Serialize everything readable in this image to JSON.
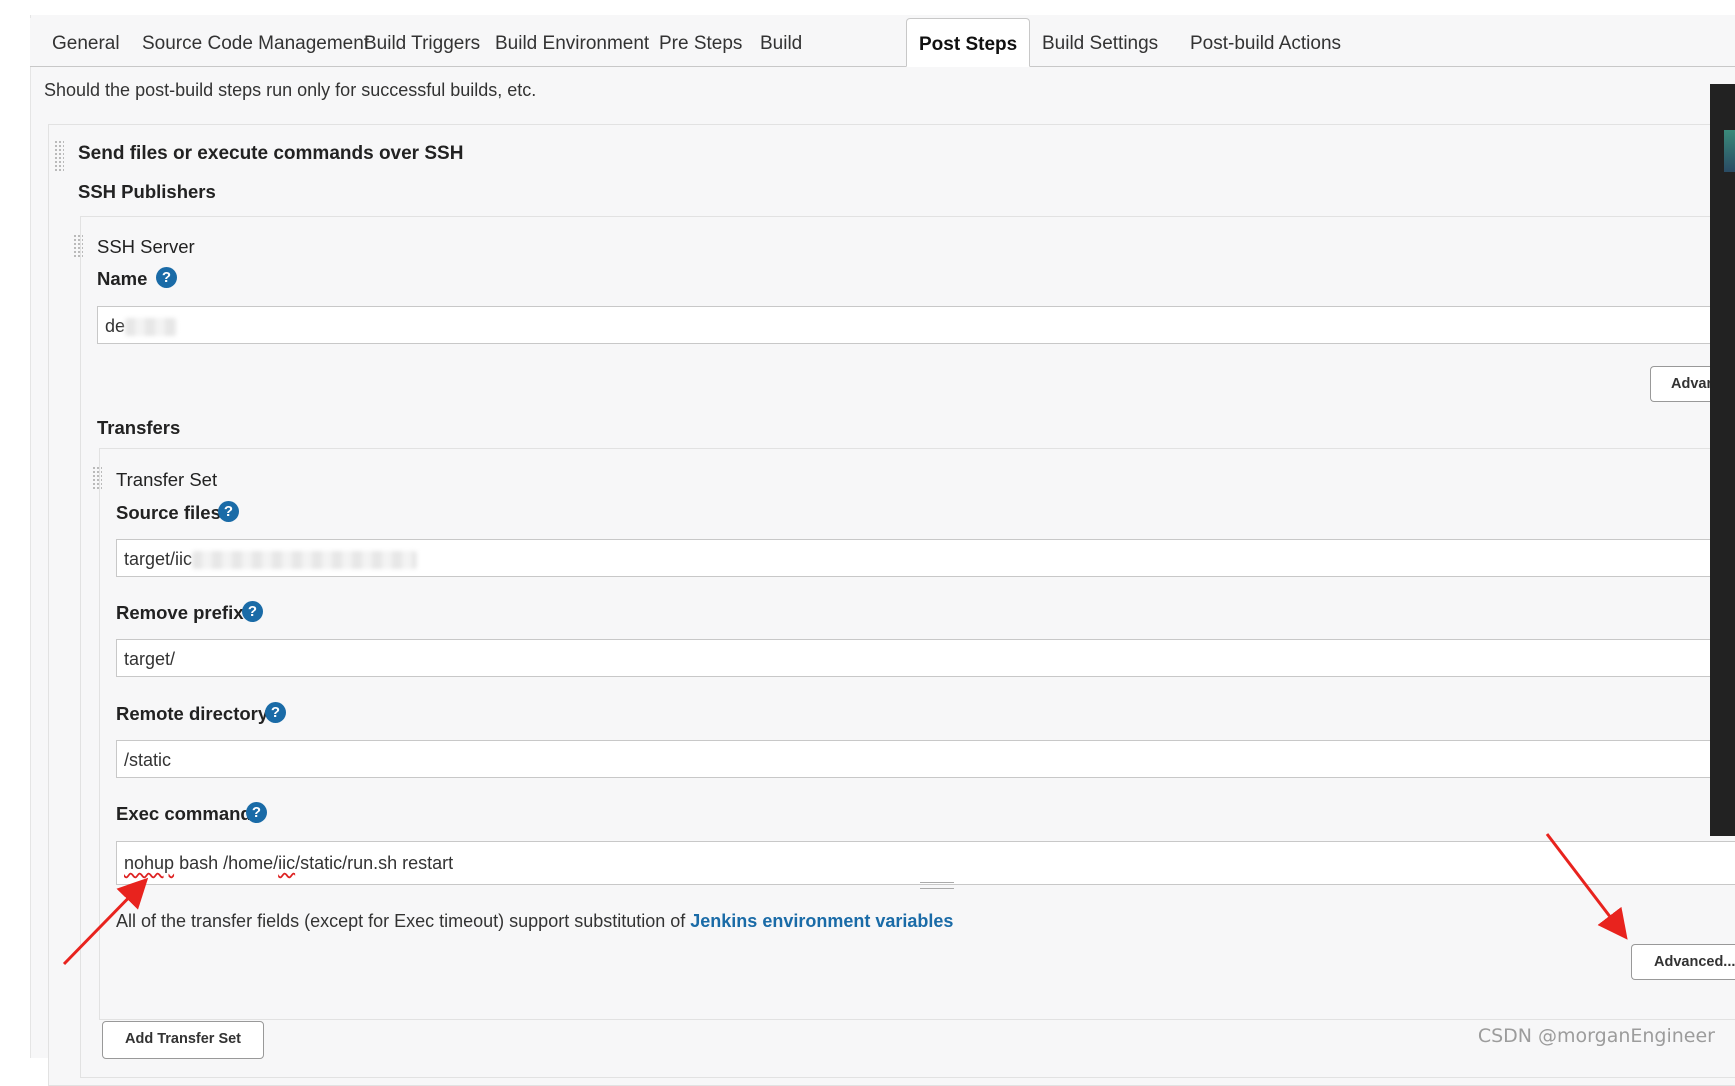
{
  "tabs": [
    {
      "label": "General",
      "active": false
    },
    {
      "label": "Source Code Management",
      "active": false
    },
    {
      "label": "Build Triggers",
      "active": false
    },
    {
      "label": "Build Environment",
      "active": false
    },
    {
      "label": "Pre Steps",
      "active": false
    },
    {
      "label": "Build",
      "active": false
    },
    {
      "label": "Post Steps",
      "active": true
    },
    {
      "label": "Build Settings",
      "active": false
    },
    {
      "label": "Post-build Actions",
      "active": false
    }
  ],
  "description": "Should the post-build steps run only for successful builds, etc.",
  "ssh_section": {
    "title": "Send files or execute commands over SSH",
    "publishers_label": "SSH Publishers",
    "server": {
      "heading": "SSH Server",
      "name_label": "Name",
      "name_value": "de",
      "advanced_button": "Advan"
    },
    "transfers_label": "Transfers",
    "transfer_set": {
      "heading": "Transfer Set",
      "source_files_label": "Source files",
      "source_files_value": "target/iic",
      "remove_prefix_label": "Remove prefix",
      "remove_prefix_value": "target/",
      "remote_directory_label": "Remote directory",
      "remote_directory_value": "/static",
      "exec_command_label": "Exec command",
      "exec_command_word1": "nohup",
      "exec_command_part2": " bash /home/",
      "exec_command_word2": "iic",
      "exec_command_part3": "/static/run.sh restart",
      "note_text": "All of the transfer fields (except for Exec timeout) support substitution of ",
      "note_link": "Jenkins environment variables",
      "advanced_button": "Advanced..."
    },
    "add_transfer_set_button": "Add Transfer Set"
  },
  "help_glyph": "?",
  "watermark": "CSDN @morganEngineer",
  "colors": {
    "accent": "#1a6ba7",
    "annotation_arrow": "#e8231e"
  }
}
